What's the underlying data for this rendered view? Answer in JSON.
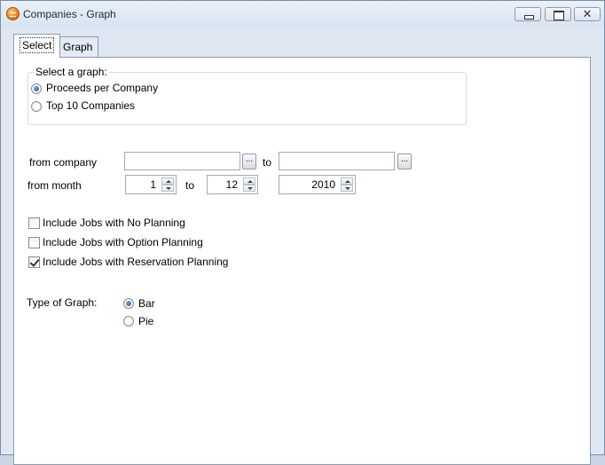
{
  "window": {
    "title": "Companies - Graph"
  },
  "tabs": [
    {
      "label": "Select"
    },
    {
      "label": "Graph"
    }
  ],
  "select_graph": {
    "legend": "Select a graph:",
    "options": [
      {
        "label": "Proceeds per Company",
        "checked": true
      },
      {
        "label": "Top 10 Companies",
        "checked": false
      }
    ]
  },
  "range": {
    "from_company_label": "from company",
    "from_company_value": "",
    "to_label": "to",
    "to_company_value": "",
    "browse_label": "...",
    "from_month_label": "from month",
    "from_month_value": "1",
    "to_month_label": "to",
    "to_month_value": "12",
    "year_value": "2010"
  },
  "include": [
    {
      "label": "Include Jobs with No Planning",
      "checked": false
    },
    {
      "label": "Include Jobs with Option Planning",
      "checked": false
    },
    {
      "label": "Include Jobs with Reservation Planning",
      "checked": true
    }
  ],
  "graph_type": {
    "label": "Type of Graph:",
    "options": [
      {
        "label": "Bar",
        "checked": true
      },
      {
        "label": "Pie",
        "checked": false
      }
    ]
  }
}
